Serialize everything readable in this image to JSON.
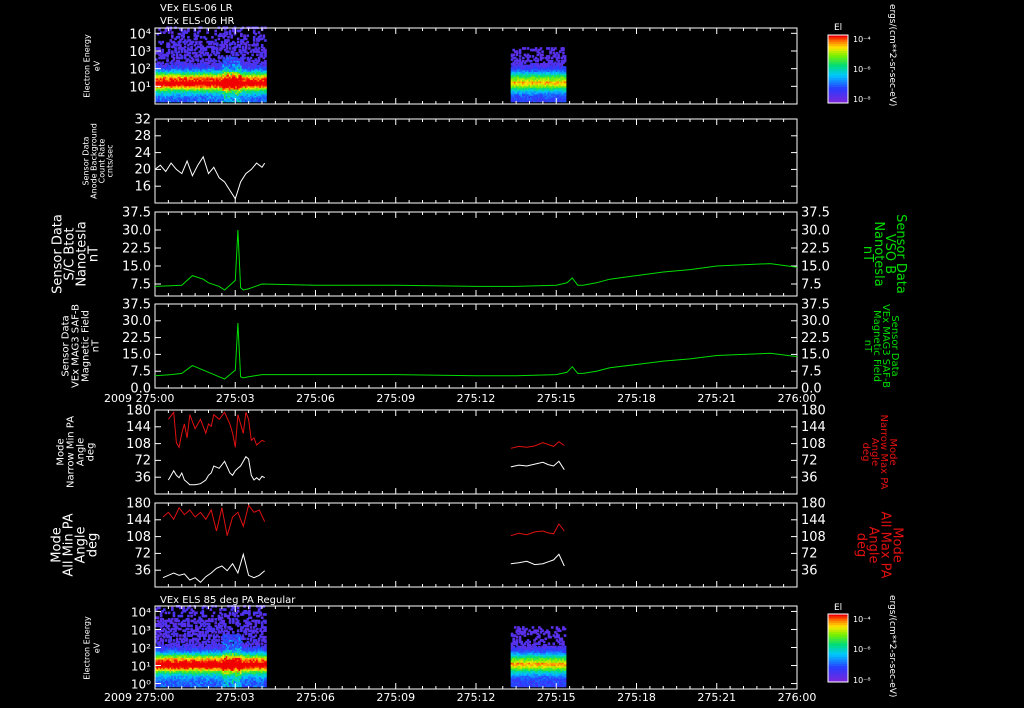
{
  "header": {
    "line1": "VEx ELS-06 LR",
    "line2": "VEx ELS-06 HR",
    "panel7_title": "VEx ELS 85 deg PA Regular"
  },
  "colors": {
    "background": "#000000",
    "frame": "#ffffff",
    "mag": "#00dd00",
    "max_pa": "#e01010",
    "min_pa": "#ffffff"
  },
  "time_axis": {
    "year_label": "2009",
    "tick_labels": [
      "275:00",
      "275:03",
      "275:06",
      "275:09",
      "275:12",
      "275:15",
      "275:18",
      "275:21",
      "276:00"
    ],
    "range_minutes": [
      0,
      24
    ]
  },
  "colorbar": {
    "label": "El",
    "tick_labels": [
      "10⁻⁴",
      "10⁻⁶",
      "10⁻⁸"
    ],
    "unit_label": "ergs/(cm**2-sr-sec-eV)"
  },
  "chart_data": [
    {
      "type": "heatmap",
      "id": "electron-energy-1",
      "ylabel_lines": [
        "Electron Energy",
        "eV"
      ],
      "y_tick_labels": [
        "10⁴",
        "10³",
        "10²",
        "10¹"
      ],
      "y_scale": "log",
      "ylim": [
        1,
        20000
      ],
      "coverage_minutes": [
        [
          0,
          4.1
        ],
        [
          13.3,
          15.3
        ]
      ],
      "colormap": "rainbow"
    },
    {
      "type": "line",
      "id": "anode-background",
      "ylabel_lines": [
        "Sensor Data",
        "Anode Background",
        "Count Rate",
        "cnts/sec"
      ],
      "ylim": [
        12,
        32
      ],
      "y_ticks": [
        16,
        20,
        24,
        28,
        32
      ],
      "series": [
        {
          "x": [
            0.0,
            0.2,
            0.4,
            0.6,
            0.8,
            1.0,
            1.2,
            1.4,
            1.6,
            1.8,
            2.0,
            2.2,
            2.4,
            2.6,
            2.8,
            3.0,
            3.2,
            3.4,
            3.6,
            3.8,
            4.0,
            4.1
          ],
          "y": [
            20,
            21,
            19.5,
            21.5,
            20,
            19,
            22,
            18.5,
            21,
            23,
            19,
            20.5,
            18,
            17,
            15,
            13,
            17,
            19,
            20,
            21.5,
            20.5,
            21.5
          ]
        }
      ]
    },
    {
      "type": "line",
      "id": "sc-btot",
      "ylabel_lines": [
        "Sensor Data",
        "S/C Btot",
        "Nanotesla",
        "nT"
      ],
      "right_label_lines": [
        "Sensor Data",
        "VSO B",
        "Nanotesla",
        "nT"
      ],
      "ylim": [
        2.5,
        37.5
      ],
      "y_ticks": [
        7.5,
        15.0,
        22.5,
        30.0,
        37.5
      ],
      "y_tick_labels": [
        "7.5",
        "15.0",
        "22.5",
        "30.0",
        "37.5"
      ],
      "series": [
        {
          "x": [
            0.0,
            0.6,
            1.0,
            1.4,
            1.8,
            2.0,
            2.4,
            2.6,
            2.8,
            3.0,
            3.1,
            3.2,
            3.3,
            3.5,
            4.0,
            6.0,
            9.0,
            12.0,
            13.5,
            15.0,
            15.4,
            15.6,
            15.8,
            16.0,
            16.5,
            17.0,
            18.0,
            19.0,
            20.0,
            21.0,
            22.0,
            23.0,
            24.0
          ],
          "y": [
            6.5,
            6.8,
            7,
            11,
            9.5,
            8,
            6.5,
            5,
            7,
            9,
            30,
            6,
            5,
            5.5,
            7.5,
            7,
            7,
            6.5,
            6.5,
            7,
            8,
            10,
            7,
            7,
            8,
            9.5,
            11,
            12.5,
            13.5,
            15,
            15.5,
            16,
            14.5
          ]
        }
      ]
    },
    {
      "type": "line",
      "id": "mag-field",
      "ylabel_lines": [
        "Sensor Data",
        "VEx MAG3 SAF-B",
        "Magnetic Field",
        "nT"
      ],
      "right_label_lines": [
        "Sensor Data",
        "VEx MAG3 SAF-B",
        "Magnetic Field",
        "nT"
      ],
      "ylim": [
        0,
        37.5
      ],
      "y_ticks": [
        0,
        7.5,
        15.0,
        22.5,
        30.0,
        37.5
      ],
      "y_tick_labels": [
        "0.0",
        "7.5",
        "15.0",
        "22.5",
        "30.0",
        "37.5"
      ],
      "series": [
        {
          "x": [
            0.0,
            0.6,
            1.0,
            1.4,
            1.8,
            2.0,
            2.4,
            2.6,
            2.8,
            3.0,
            3.1,
            3.2,
            3.3,
            3.5,
            4.0,
            6.0,
            9.0,
            12.0,
            13.5,
            15.0,
            15.4,
            15.6,
            15.8,
            16.0,
            16.5,
            17.0,
            18.0,
            19.0,
            20.0,
            21.0,
            22.0,
            23.0,
            24.0
          ],
          "y": [
            5.5,
            6,
            6.5,
            10,
            8,
            7,
            5,
            4,
            6,
            8,
            29,
            5,
            4.5,
            5,
            6,
            6,
            6,
            5.5,
            5.5,
            6,
            7,
            9.5,
            6.5,
            6.5,
            7.5,
            9,
            10.5,
            12,
            13,
            14.5,
            15,
            15.5,
            14
          ]
        }
      ]
    },
    {
      "type": "line",
      "id": "narrow-pa",
      "ylabel_lines": [
        "Mode",
        "Narrow Min PA",
        "Angle",
        "deg"
      ],
      "right_label_lines": [
        "Mode",
        "Narrow Max PA",
        "Angle",
        "deg"
      ],
      "ylim": [
        0,
        180
      ],
      "y_ticks": [
        36,
        72,
        108,
        144,
        180
      ],
      "series": [
        {
          "name": "max",
          "x": [
            0.5,
            0.7,
            0.8,
            0.9,
            1.0,
            1.1,
            1.2,
            1.3,
            1.5,
            1.7,
            1.9,
            2.0,
            2.1,
            2.2,
            2.4,
            2.6,
            2.8,
            2.9,
            3.0,
            3.1,
            3.2,
            3.3,
            3.4,
            3.5,
            3.6,
            3.7,
            3.8,
            3.9,
            4.0,
            4.1
          ],
          "y": [
            160,
            175,
            110,
            100,
            130,
            150,
            120,
            170,
            140,
            160,
            130,
            150,
            145,
            170,
            160,
            175,
            150,
            130,
            100,
            170,
            150,
            130,
            175,
            160,
            115,
            120,
            105,
            110,
            115,
            112
          ]
        },
        {
          "name": "min",
          "x": [
            0.5,
            0.7,
            0.8,
            0.9,
            1.0,
            1.1,
            1.2,
            1.3,
            1.5,
            1.7,
            1.9,
            2.0,
            2.1,
            2.2,
            2.4,
            2.6,
            2.8,
            2.9,
            3.0,
            3.1,
            3.2,
            3.3,
            3.4,
            3.5,
            3.6,
            3.7,
            3.8,
            3.9,
            4.0,
            4.1
          ],
          "y": [
            30,
            50,
            40,
            35,
            45,
            30,
            25,
            20,
            20,
            22,
            30,
            40,
            45,
            60,
            55,
            70,
            45,
            40,
            50,
            55,
            60,
            70,
            80,
            75,
            40,
            30,
            35,
            30,
            38,
            35
          ]
        },
        {
          "name": "max",
          "x": [
            13.3,
            13.6,
            13.9,
            14.2,
            14.5,
            14.7,
            14.9,
            15.1,
            15.3
          ],
          "y": [
            98,
            102,
            100,
            103,
            110,
            106,
            102,
            112,
            104
          ]
        },
        {
          "name": "min",
          "x": [
            13.3,
            13.6,
            13.9,
            14.2,
            14.5,
            14.7,
            14.9,
            15.1,
            15.3
          ],
          "y": [
            58,
            62,
            60,
            64,
            68,
            63,
            60,
            70,
            52
          ]
        }
      ]
    },
    {
      "type": "line",
      "id": "all-pa",
      "ylabel_lines": [
        "Mode",
        "All Min PA",
        "Angle",
        "deg"
      ],
      "right_label_lines": [
        "Mode",
        "All Max PA",
        "Angle",
        "deg"
      ],
      "ylim": [
        0,
        180
      ],
      "y_ticks": [
        36,
        72,
        108,
        144,
        180
      ],
      "series": [
        {
          "name": "max",
          "x": [
            0.3,
            0.5,
            0.7,
            0.9,
            1.1,
            1.3,
            1.5,
            1.7,
            1.9,
            2.1,
            2.3,
            2.5,
            2.7,
            2.9,
            3.1,
            3.3,
            3.5,
            3.7,
            3.9,
            4.1
          ],
          "y": [
            150,
            160,
            145,
            170,
            155,
            165,
            150,
            160,
            145,
            165,
            120,
            170,
            110,
            150,
            160,
            130,
            175,
            160,
            165,
            140
          ]
        },
        {
          "name": "min",
          "x": [
            0.3,
            0.5,
            0.7,
            0.9,
            1.1,
            1.3,
            1.5,
            1.7,
            1.9,
            2.1,
            2.3,
            2.5,
            2.7,
            2.9,
            3.1,
            3.3,
            3.5,
            3.7,
            3.9,
            4.1
          ],
          "y": [
            20,
            25,
            30,
            25,
            28,
            15,
            20,
            10,
            22,
            30,
            40,
            45,
            35,
            50,
            30,
            70,
            25,
            20,
            25,
            35
          ]
        },
        {
          "name": "max",
          "x": [
            13.3,
            13.6,
            13.9,
            14.2,
            14.5,
            14.7,
            14.9,
            15.1,
            15.3
          ],
          "y": [
            110,
            115,
            112,
            118,
            120,
            116,
            114,
            135,
            120
          ]
        },
        {
          "name": "min",
          "x": [
            13.3,
            13.6,
            13.9,
            14.2,
            14.5,
            14.7,
            14.9,
            15.1,
            15.3
          ],
          "y": [
            50,
            52,
            55,
            48,
            50,
            54,
            58,
            70,
            45
          ]
        }
      ]
    },
    {
      "type": "heatmap",
      "id": "electron-energy-2",
      "ylabel_lines": [
        "Electron Energy",
        "eV"
      ],
      "y_tick_labels": [
        "10⁴",
        "10³",
        "10²",
        "10¹",
        "10⁰"
      ],
      "y_scale": "log",
      "ylim": [
        0.5,
        20000
      ],
      "coverage_minutes": [
        [
          0,
          4.1
        ],
        [
          13.3,
          15.3
        ]
      ],
      "colormap": "rainbow"
    }
  ]
}
